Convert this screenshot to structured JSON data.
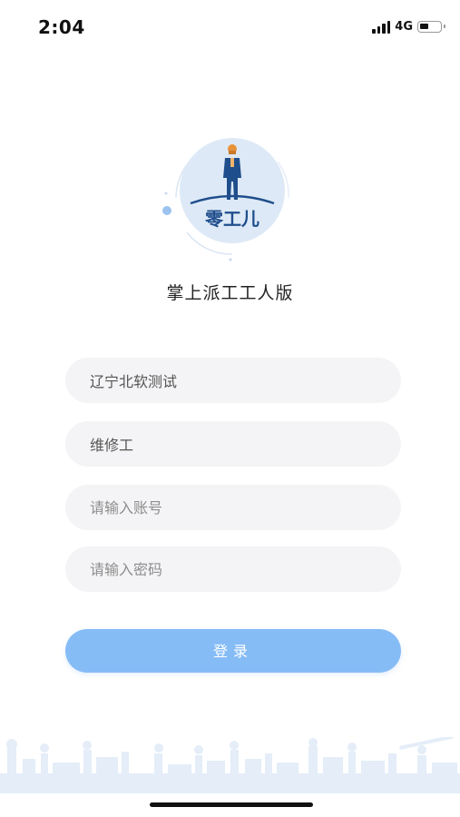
{
  "status_bar": {
    "time": "2:04",
    "network": "4G",
    "signal_bars": 4,
    "battery_level": 0.4
  },
  "logo": {
    "brand_text": "零工儿",
    "icon": "construction-worker-logo"
  },
  "app": {
    "title": "掌上派工工人版"
  },
  "form": {
    "company": {
      "value": "辽宁北软测试"
    },
    "role": {
      "value": "维修工"
    },
    "account": {
      "placeholder": "请输入账号",
      "value": ""
    },
    "password": {
      "placeholder": "请输入密码",
      "value": ""
    },
    "login_label": "登录"
  },
  "footer": {
    "icon": "worker-silhouettes-icon"
  },
  "colors": {
    "accent": "#86bcf6",
    "field_bg": "#f4f4f6",
    "logo_bg": "#dde9f6",
    "logo_navy": "#1f4e8c",
    "footer_tint": "#e3edf8"
  }
}
